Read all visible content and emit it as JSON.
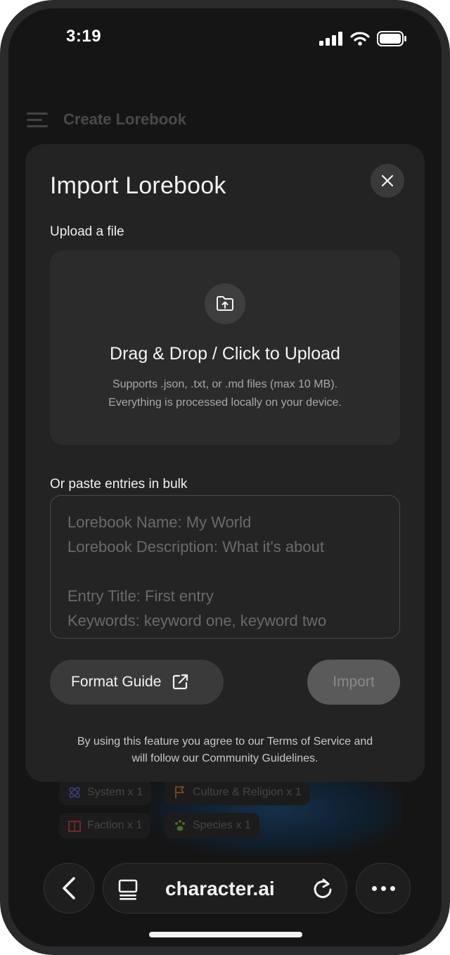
{
  "status_bar": {
    "time": "3:19"
  },
  "background": {
    "header_title": "Create Lorebook",
    "chips": [
      {
        "label": "System x 1",
        "icon": "atom-icon",
        "color": "#3a3f7a"
      },
      {
        "label": "Culture & Religion x 1",
        "icon": "flag-icon",
        "color": "#7a4a1a"
      },
      {
        "label": "Faction x 1",
        "icon": "building-icon",
        "color": "#7a2a2a"
      },
      {
        "label": "Species x 1",
        "icon": "paw-icon",
        "color": "#4a6a2a"
      }
    ]
  },
  "modal": {
    "title": "Import Lorebook",
    "upload_label": "Upload a file",
    "dropzone": {
      "title": "Drag & Drop / Click to Upload",
      "subtitle_line1": "Supports .json, .txt, or .md files (max 10 MB).",
      "subtitle_line2": "Everything is processed locally on your device."
    },
    "bulk_label": "Or paste entries in bulk",
    "bulk_placeholder": {
      "line1": "Lorebook Name: My World",
      "line2": "Lorebook Description: What it's about",
      "line3": "",
      "line4": "Entry Title: First entry",
      "line5": "Keywords: keyword one, keyword two"
    },
    "format_guide_label": "Format Guide",
    "import_label": "Import",
    "terms_line1": "By using this feature you agree to our Terms of Service and",
    "terms_line2": "will follow our Community Guidelines."
  },
  "browser": {
    "url": "character.ai"
  }
}
